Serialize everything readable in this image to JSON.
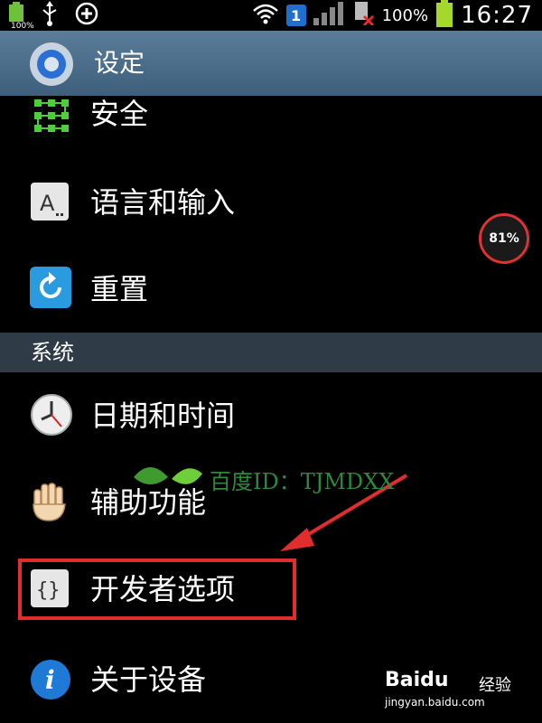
{
  "status_bar": {
    "battery_small_label": "100%",
    "notification_count": "1",
    "battery_percent": "100%",
    "time": "16:27"
  },
  "title_bar": {
    "title": "设定"
  },
  "settings_items": [
    {
      "label": "安全",
      "icon": "security-grid-icon"
    },
    {
      "label": "语言和输入",
      "icon": "keyboard-a-icon"
    },
    {
      "label": "重置",
      "icon": "reset-icon"
    }
  ],
  "system_section": {
    "header": "系统",
    "items": [
      {
        "label": "日期和时间",
        "icon": "clock-icon"
      },
      {
        "label": "辅助功能",
        "icon": "hand-icon"
      },
      {
        "label": "开发者选项",
        "icon": "braces-icon"
      },
      {
        "label": "关于设备",
        "icon": "info-icon"
      }
    ]
  },
  "overlay": {
    "floating_percent": "81%",
    "watermark": "百度ID：TJMDXX"
  },
  "brand": {
    "name": "Baidu",
    "experience": "经验",
    "url": "jingyan.baidu.com"
  },
  "colors": {
    "highlight": "#e12d2d",
    "title_bar": "#4a6b87",
    "section_header": "#2f3b46",
    "watermark": "#2c8a3b"
  }
}
